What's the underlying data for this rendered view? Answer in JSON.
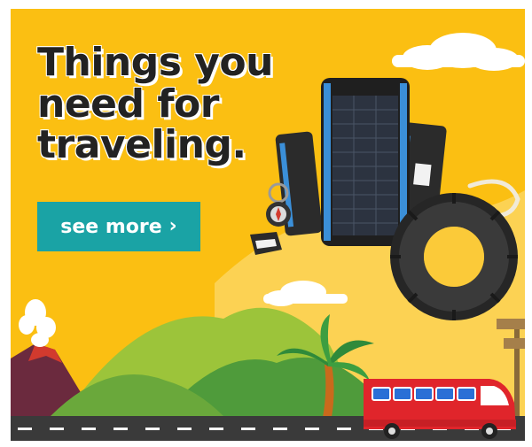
{
  "ad": {
    "headline": [
      "Things you",
      "need for",
      "traveling."
    ],
    "cta": {
      "label": "see more",
      "chevron": "›"
    },
    "colors": {
      "background": "#fbbf12",
      "cta": "#1aa3a5",
      "headline": "#222222",
      "bus": "#e0252b",
      "road": "#3a3a3a"
    },
    "products": [
      "solar-power-bank",
      "compass-keychain",
      "rubber-ring-handle"
    ],
    "scene_icons": [
      "cloud-icon",
      "volcano-icon",
      "hills-icon",
      "palm-tree-icon",
      "bus-icon",
      "signpost-icon",
      "road-icon"
    ]
  }
}
